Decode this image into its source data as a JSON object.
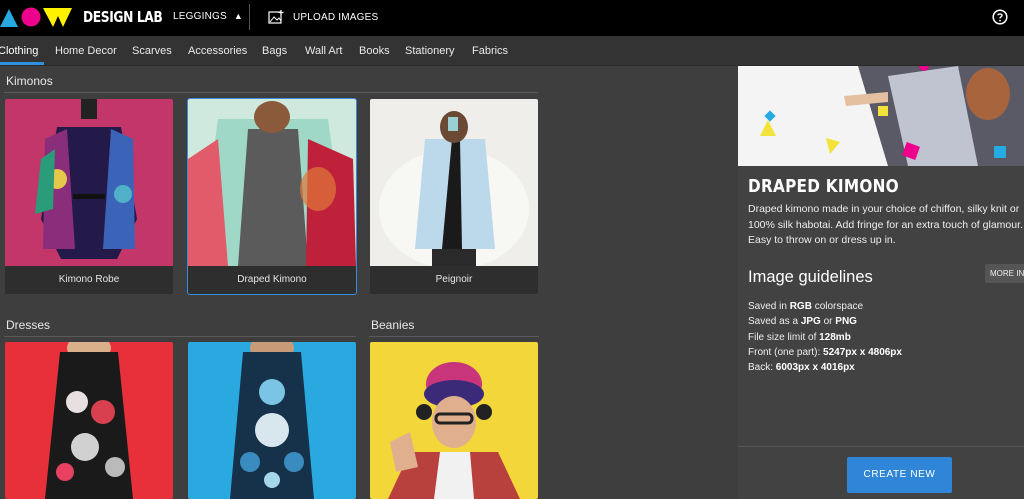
{
  "app": {
    "brand": "DESIGN LAB"
  },
  "topbar": {
    "product": "LEGGINGS",
    "upload_label": "UPLOAD IMAGES"
  },
  "categories": [
    "Clothing",
    "Home Decor",
    "Scarves",
    "Accessories",
    "Bags",
    "Wall Art",
    "Books",
    "Stationery",
    "Fabrics"
  ],
  "active_category": "Clothing",
  "sections": {
    "kimonos": {
      "title": "Kimonos",
      "items": [
        {
          "label": "Kimono Robe",
          "selected": false
        },
        {
          "label": "Draped Kimono",
          "selected": true
        },
        {
          "label": "Peignoir",
          "selected": false
        }
      ]
    },
    "dresses": {
      "title": "Dresses"
    },
    "beanies": {
      "title": "Beanies"
    }
  },
  "panel": {
    "product_title": "DRAPED KIMONO",
    "description_lines": [
      "Draped kimono made in your choice of chiffon, silky knit or",
      "100% silk habotai. Add fringe for an extra touch of glamour.",
      "Easy to throw on or dress up in."
    ],
    "guidelines_title": "Image guidelines",
    "more_info_label": "MORE INFO",
    "guidelines": [
      {
        "prefix": "Saved in ",
        "bold": "RGB",
        "suffix": " colorspace"
      },
      {
        "prefix": "Saved as a ",
        "bold": "JPG",
        "suffix": " or ",
        "bold2": "PNG"
      },
      {
        "prefix": "File size limit of ",
        "bold": "128mb",
        "suffix": ""
      },
      {
        "prefix": "Front (one part): ",
        "bold": "5247px x 4806px",
        "suffix": ""
      },
      {
        "prefix": "Back: ",
        "bold": "6003px x 4016px",
        "suffix": ""
      }
    ],
    "create_label": "CREATE NEW"
  },
  "colors": {
    "accent": "#2f86d8",
    "logo_blue": "#27aae1",
    "logo_pink": "#ec008c",
    "logo_yellow": "#fff200"
  }
}
